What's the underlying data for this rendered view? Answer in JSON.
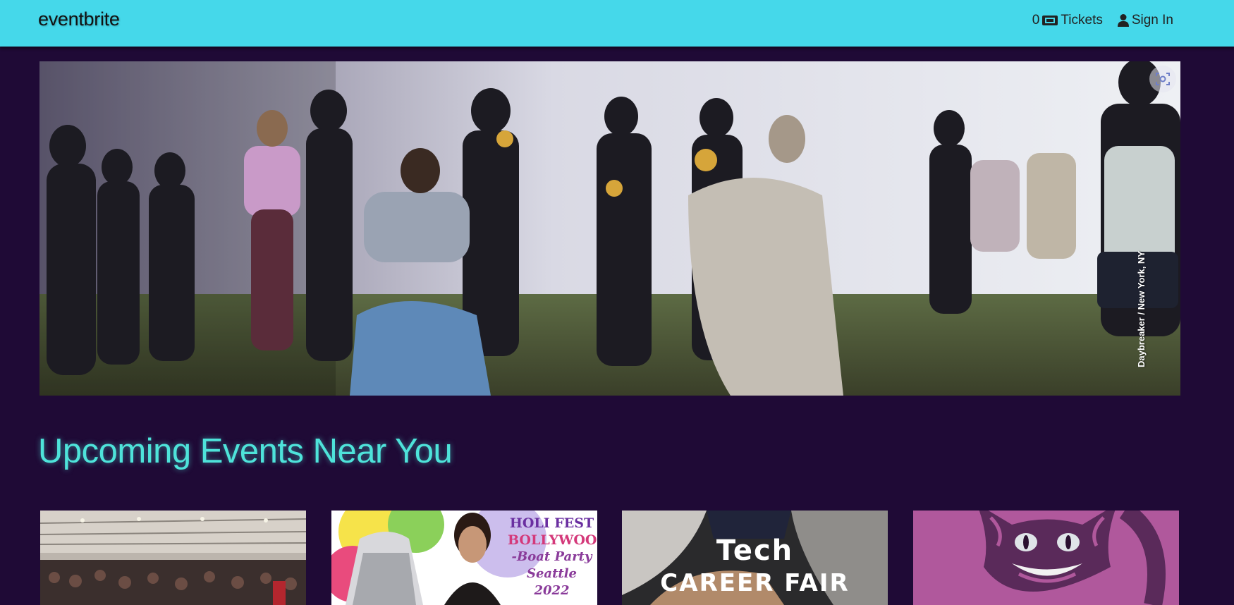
{
  "header": {
    "logo": "eventbrite",
    "ticket_count": "0",
    "tickets_label": "Tickets",
    "sign_in_label": "Sign In"
  },
  "hero": {
    "photo_description": "Crowd of people dancing with headphones and a brass band playing outdoors",
    "credit": "Daybreaker / New York, NY"
  },
  "section": {
    "title": "Upcoming Events Near You"
  },
  "events": [
    {
      "image_icon": "warehouse-crowd-photo"
    },
    {
      "line1": "HOLI FEST",
      "line2": "BOLLYWOOD",
      "line3": "-Boat Party",
      "line4": "Seattle 2022"
    },
    {
      "line1": "Tech",
      "line2": "CAREER FAIR"
    },
    {
      "image_icon": "cheshire-cat-illustration"
    }
  ],
  "colors": {
    "header_bg": "#45d8ea",
    "page_bg": "#1f0a36",
    "title_color": "#4ee3da"
  }
}
